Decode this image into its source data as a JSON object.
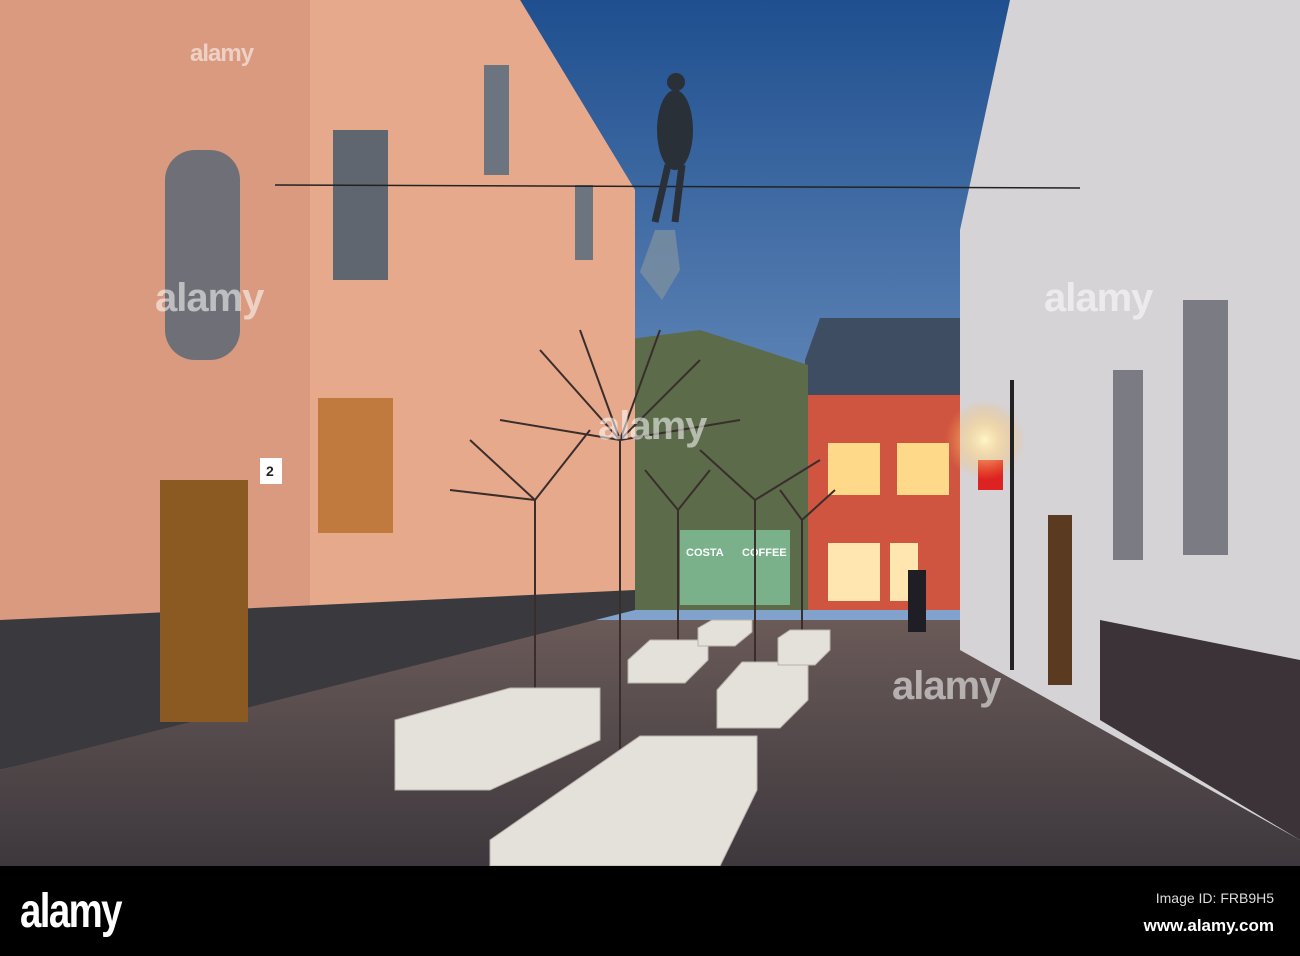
{
  "photo": {
    "shop_signs": [
      "COSTA",
      "COFFEE"
    ],
    "house_number": "2",
    "watermarks": [
      "alamy",
      "alamy",
      "alamy",
      "alamy",
      "alamy"
    ]
  },
  "footer": {
    "logo": "alamy",
    "image_id": "Image ID: FRB9H5",
    "url": "www.alamy.com"
  },
  "colors": {
    "sky_top": "#1f4f8f",
    "sky_bottom": "#a9c4e4",
    "left_wall": "#d99a7f",
    "right_wall": "#d6d3d6",
    "pavement": "#4a4449"
  }
}
